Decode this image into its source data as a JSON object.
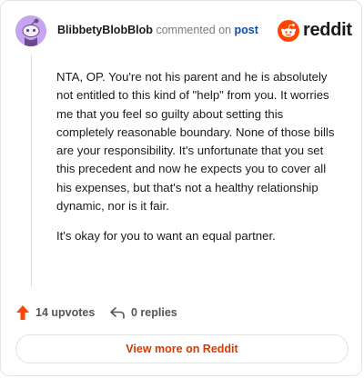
{
  "header": {
    "username": "BlibbetyBlobBlob",
    "action_text": "commented on",
    "post_link": "post",
    "brand": "reddit"
  },
  "comment": {
    "paragraphs": [
      "NTA, OP. You're not his parent and he is absolutely not entitled to this kind of \"help\" from you. It worries me that you feel so guilty about setting this completely reasonable boundary. None of those bills are your responsibility. It's unfortunate that you set this precedent and now he expects you to cover all his expenses, but that's not a healthy relationship dynamic, nor is it fair.",
      "It's okay for you to want an equal partner."
    ]
  },
  "actions": {
    "upvotes": "14 upvotes",
    "replies": "0 replies"
  },
  "footer": {
    "view_more": "View more on Reddit"
  },
  "colors": {
    "accent": "#ff4500",
    "link": "#0b4cb0",
    "button_text": "#d93900",
    "avatar_bg": "#c7a4f0"
  },
  "icons": [
    "snoo-avatar-icon",
    "reddit-logo-icon",
    "upvote-arrow-icon",
    "reply-icon"
  ]
}
